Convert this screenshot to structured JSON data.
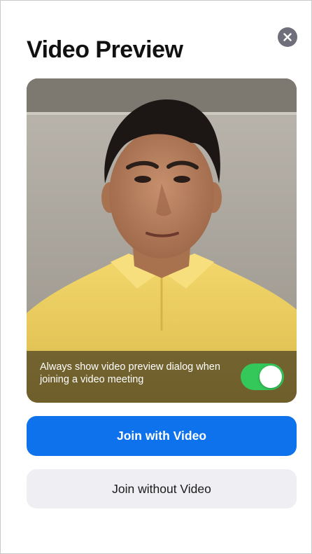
{
  "dialog": {
    "title": "Video Preview",
    "close_icon": "close-icon"
  },
  "preview": {
    "setting_text": "Always show video preview dialog when joining a video meeting",
    "toggle_on": true
  },
  "actions": {
    "join_with_video_label": "Join with Video",
    "join_without_video_label": "Join without Video"
  },
  "colors": {
    "primary": "#0e72ed",
    "toggle_on": "#34c759",
    "secondary_bg": "#eeeef3",
    "close_bg": "#6e6f7a"
  }
}
